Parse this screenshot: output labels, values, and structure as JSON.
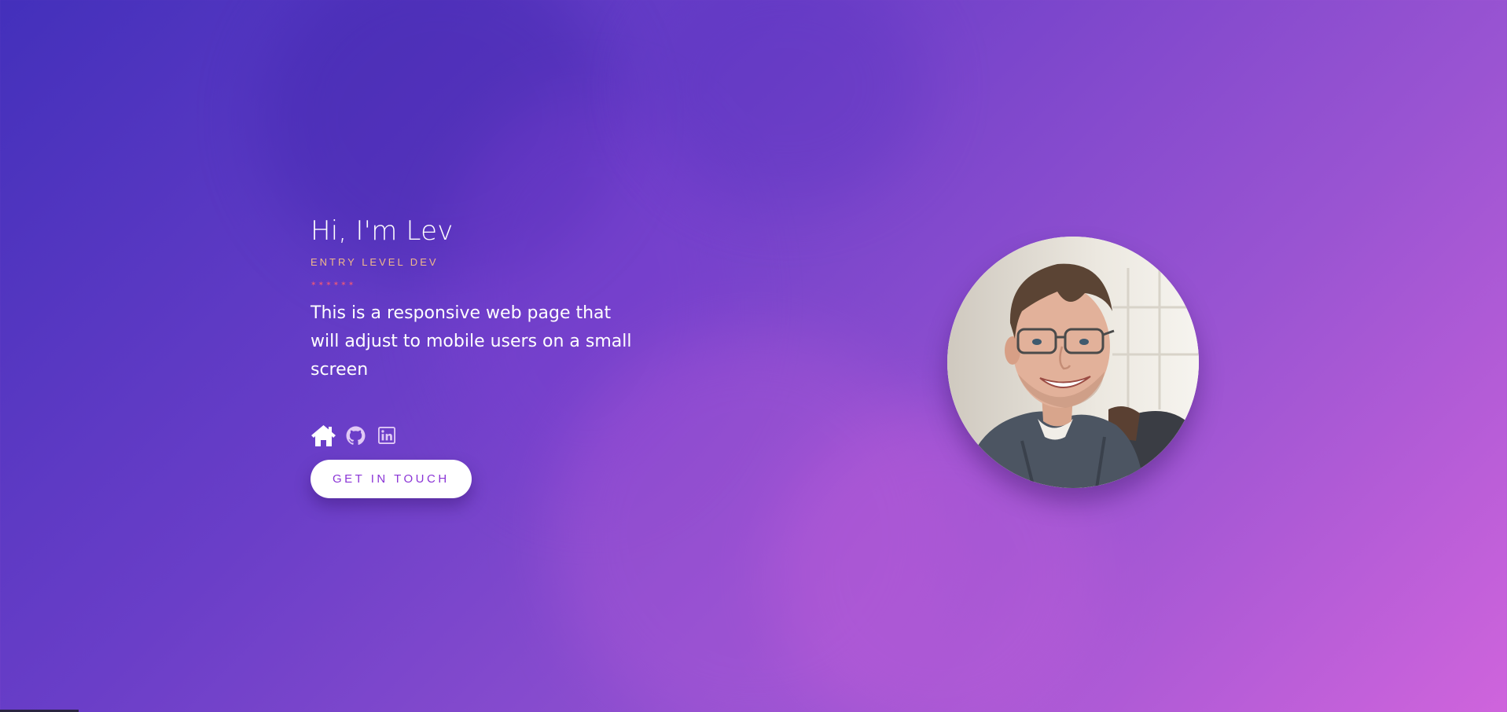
{
  "hero": {
    "title": "Hi, I'm Lev",
    "subtitle": "ENTRY LEVEL DEV",
    "divider": "✶✶✶✶✶✶",
    "description": "This is a responsive web page that will adjust to mobile users on a small screen",
    "cta_label": "GET IN TOUCH"
  },
  "social": [
    {
      "icon": "home-icon"
    },
    {
      "icon": "github-icon"
    },
    {
      "icon": "linkedin-icon"
    }
  ],
  "colors": {
    "background_start": "#4330bb",
    "background_end": "#cf64dc",
    "subtitle": "#f0b98a",
    "divider": "#e2557d",
    "button_text": "#8b35d6",
    "button_bg": "#ffffff"
  }
}
